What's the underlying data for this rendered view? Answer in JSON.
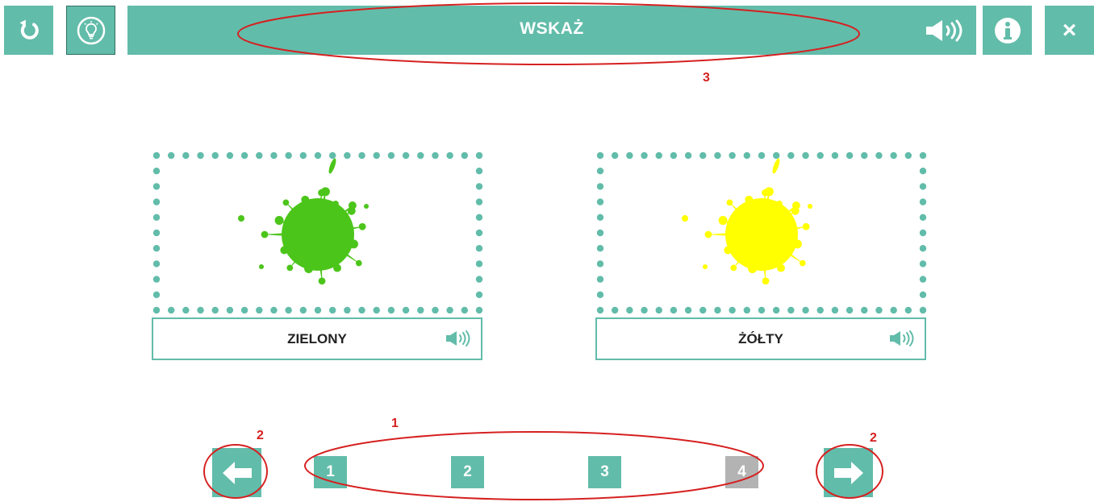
{
  "toolbar": {
    "reset_icon": "reset-icon",
    "hint_icon": "lightbulb-icon",
    "title": "WSKAŻ",
    "speaker_icon": "speaker-icon",
    "info_icon": "info-icon",
    "close_label": "×"
  },
  "cards": [
    {
      "label": "ZIELONY",
      "splash_color": "#4cc51a",
      "speaker_icon": "speaker-icon"
    },
    {
      "label": "ŻÓŁTY",
      "splash_color": "#ffff00",
      "speaker_icon": "speaker-icon"
    }
  ],
  "pagination": {
    "pages": [
      "1",
      "2",
      "3",
      "4"
    ],
    "disabled_page": "4",
    "prev_icon": "arrow-left-icon",
    "next_icon": "arrow-right-icon"
  },
  "annotations": {
    "pagination_marker": "1",
    "arrow_marker_left": "2",
    "arrow_marker_right": "2",
    "title_marker": "3"
  },
  "colors": {
    "accent": "#62bcaa",
    "disabled": "#b3b3b3",
    "annotation": "#d62020"
  }
}
